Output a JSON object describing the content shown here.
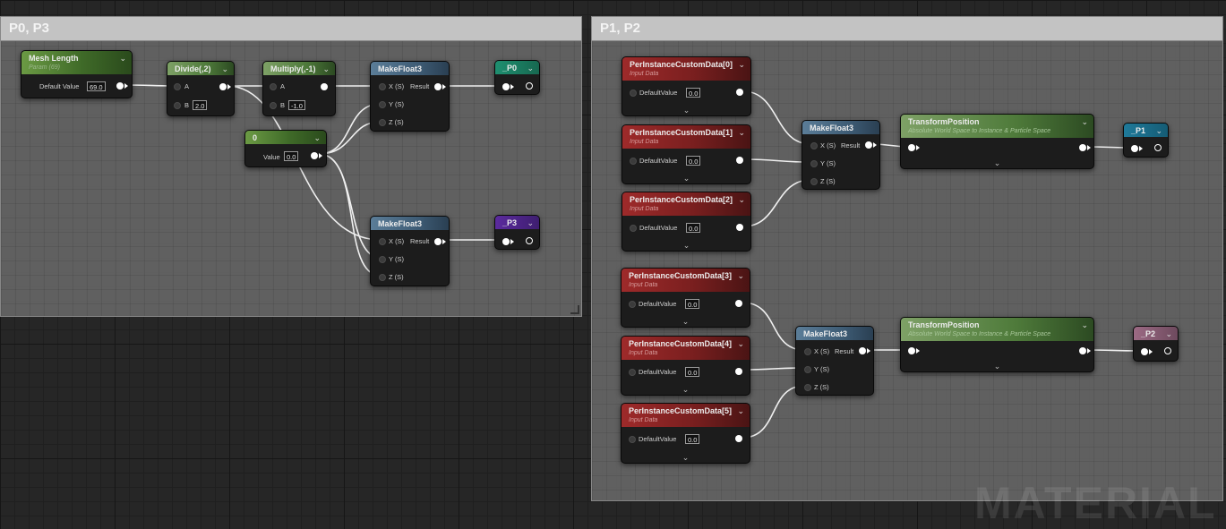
{
  "watermark": "MATERIAL",
  "comments": {
    "left": {
      "title": "P0, P3"
    },
    "right": {
      "title": "P1, P2"
    }
  },
  "nodes": {
    "mesh_length": {
      "title": "Mesh Length",
      "subtitle": "Param (69)",
      "pin_label": "Default Value",
      "value": "69.0"
    },
    "divide": {
      "title": "Divide(,2)",
      "pin_a": "A",
      "pin_b": "B",
      "b_value": "2.0"
    },
    "multiply": {
      "title": "Multiply(,-1)",
      "pin_a": "A",
      "pin_b": "B",
      "b_value": "-1.0"
    },
    "zero_const": {
      "title": "0",
      "pin_label": "Value",
      "value": "0.0"
    },
    "make_float3_a": {
      "title": "MakeFloat3",
      "x": "X (S)",
      "y": "Y (S)",
      "z": "Z (S)",
      "result": "Result"
    },
    "make_float3_b": {
      "title": "MakeFloat3",
      "x": "X (S)",
      "y": "Y (S)",
      "z": "Z (S)",
      "result": "Result"
    },
    "out_p0": {
      "title": "_P0"
    },
    "out_p3": {
      "title": "_P3"
    },
    "pic0": {
      "title": "PerInstanceCustomData[0]",
      "subtitle": "Input Data",
      "pin_label": "DefaultValue",
      "value": "0.0"
    },
    "pic1": {
      "title": "PerInstanceCustomData[1]",
      "subtitle": "Input Data",
      "pin_label": "DefaultValue",
      "value": "0.0"
    },
    "pic2": {
      "title": "PerInstanceCustomData[2]",
      "subtitle": "Input Data",
      "pin_label": "DefaultValue",
      "value": "0.0"
    },
    "pic3": {
      "title": "PerInstanceCustomData[3]",
      "subtitle": "Input Data",
      "pin_label": "DefaultValue",
      "value": "0.0"
    },
    "pic4": {
      "title": "PerInstanceCustomData[4]",
      "subtitle": "Input Data",
      "pin_label": "DefaultValue",
      "value": "0.0"
    },
    "pic5": {
      "title": "PerInstanceCustomData[5]",
      "subtitle": "Input Data",
      "pin_label": "DefaultValue",
      "value": "0.0"
    },
    "make_float3_c": {
      "title": "MakeFloat3",
      "x": "X (S)",
      "y": "Y (S)",
      "z": "Z (S)",
      "result": "Result"
    },
    "make_float3_d": {
      "title": "MakeFloat3",
      "x": "X (S)",
      "y": "Y (S)",
      "z": "Z (S)",
      "result": "Result"
    },
    "transform_a": {
      "title": "TransformPosition",
      "subtitle": "Absolute World Space to Instance & Particle Space"
    },
    "transform_b": {
      "title": "TransformPosition",
      "subtitle": "Absolute World Space to Instance & Particle Space"
    },
    "out_p1": {
      "title": "_P1"
    },
    "out_p2": {
      "title": "_P2"
    }
  },
  "colors": {
    "wire": "#f0f0f0",
    "param_header": "#4f7f34",
    "math_header": "#4e7a3a",
    "make_float3_header": "#3e5c75",
    "custom_data_header": "#7a1f1f",
    "p0_header": "#1e8f70",
    "p3_header": "#5b2a9e",
    "p1_header": "#1f7a9a",
    "p2_header": "#9c6a84"
  }
}
